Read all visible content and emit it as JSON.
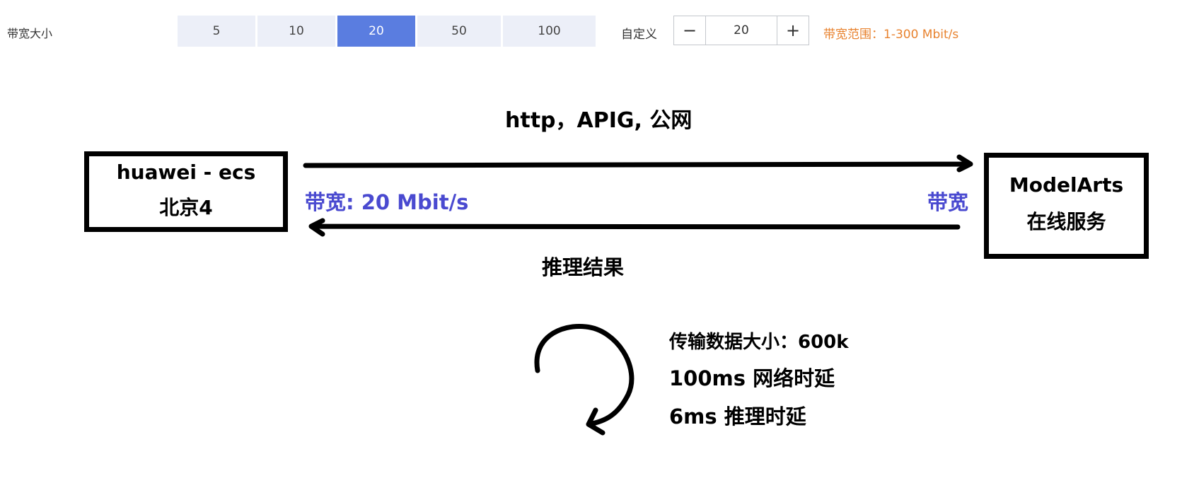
{
  "bandwidth": {
    "label": "带宽大小",
    "options": [
      "5",
      "10",
      "20",
      "50",
      "100"
    ],
    "selected": "20",
    "custom_label": "自定义",
    "custom_value": "20",
    "minus_symbol": "−",
    "plus_symbol": "+",
    "range_hint": "带宽范围：1-300 Mbit/s"
  },
  "diagram": {
    "client": {
      "line1": "huawei - ecs",
      "line2": "北京4"
    },
    "server": {
      "line1": "ModelArts",
      "line2": "在线服务"
    },
    "request_label": "http，APIG, 公网",
    "bandwidth_left": "带宽: 20 Mbit/s",
    "bandwidth_right": "带宽",
    "response_label": "推理结果",
    "stats": {
      "data_size": "传输数据大小：600k",
      "network_latency": "100ms 网络时延",
      "inference_latency": "6ms 推理时延"
    }
  },
  "colors": {
    "selected_option": "#5a7de0",
    "option_bg": "#eceff8",
    "range_hint": "#e8822e",
    "bandwidth_text": "#4a4ad0"
  },
  "icons": {
    "minus": "minus-icon",
    "plus": "plus-icon",
    "cycle": "circular-arrow-icon"
  }
}
